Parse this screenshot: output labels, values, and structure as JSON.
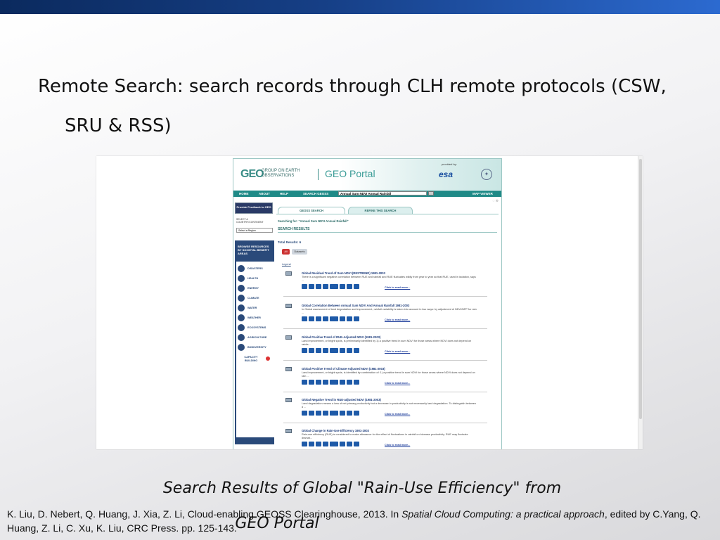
{
  "slide": {
    "title_line1": "Remote Search: search records through CLH remote protocols (CSW,",
    "title_line2": "SRU & RSS)",
    "caption_line1": "Search Results of Global \"Rain-Use Efficiency\" from",
    "caption_line2": "GEO Portal",
    "citation_pre": "K. Liu, D. Nebert, Q. Huang, J. Xia, Z. Li, Cloud-enabling GEOSS  Clearinghouse, 2013. In ",
    "citation_book": "Spatial Cloud Computing: a practical approach",
    "citation_post": ", edited by C.Yang, Q. Huang, Z. Li, C. Xu, K. Liu, CRC Press. pp. 125-143."
  },
  "portal": {
    "logo_geo": "GEO",
    "logo_sub": "GROUP ON EARTH OBSERVATIONS",
    "portal_name": "GEO Portal",
    "provided_by": "provided by:",
    "esa": "esa",
    "nav": {
      "home": "HOME",
      "about": "ABOUT",
      "help": "HELP",
      "search_geoss": "SEARCH GEOSS",
      "search_value": "Annual Sum NDVI Annual Rainfall",
      "map_viewer": "MAP VIEWER"
    },
    "sidebar": {
      "feedback": "Provide Feedback to GEO",
      "select_label": "SELECT A COUNTRY/CONTINENT",
      "select_value": "Select a Region",
      "browse": "BROWSE RESOURCES BY SOCIETAL BENEFIT AREAS",
      "items": [
        "DISASTERS",
        "HEALTH",
        "ENERGY",
        "CLIMATE",
        "WATER",
        "WEATHER",
        "ECOSYSTEMS",
        "AGRICULTURE",
        "BIODIVERSITY"
      ],
      "capacity": "CAPACITY BUILDING"
    },
    "tabs": {
      "geoss_search": "GEOSS SEARCH",
      "refine": "REFINE THIS SEARCH"
    },
    "searching_for": "Searching for: \"Annual Sum NDVI Annual Rainfall\"",
    "search_results": "SEARCH RESULTS",
    "total_results": "Total Results: 6",
    "filter_all": "All",
    "filter_datasets": "Datasets",
    "legend": "Legend",
    "read_more": "Click to read more...",
    "results": [
      {
        "title": "Global Residual Trend of Sum NDVI (RESTREND) 1981-2003",
        "desc": "There is a significant negative correlation between RUE and rainfall and RUE fluctuates wildly from year to year so that RUE, used in isolation, says ..."
      },
      {
        "title": "Global Correlation Between Annual Sum NDVI And Annual Rainfall 1981-2003",
        "desc": "In Global assessment of land degradation and improvement, rainfall variability is taken into account in two ways: by adjustment of NDVI/NPP for rain ..."
      },
      {
        "title": "Global Positive Trend of RUE-Adjusted NDVI (1981-2003)",
        "desc": "Land improvement, or bright spots, is preliminarily identified by 1) a positive trend in sum NDVI for those areas where NDVI does not depend on rainfa..."
      },
      {
        "title": "Global Positive Trend of Climate-Adjusted NDVI (1981-2003)",
        "desc": "Land improvement, or bright spots, is identified by combination of: 1) a positive trend in sum NDVI for those areas where NDVI does not depend on rain ..."
      },
      {
        "title": "Global Negative Trend in RUE-adjusted NDVI (1981-2003)",
        "desc": "Land degradation means a loss of net primary productivity but a decrease in productivity is not necessarily land degradation. To distinguish between d ..."
      },
      {
        "title": "Global Change in Rain-Use Efficiency 1981-2003",
        "desc": "Rain-use efficiency (RUE) is considered to make allowance for the effect of fluctuations in rainfall on biomass productivity. RUE may fluctuate dramat..."
      }
    ]
  }
}
